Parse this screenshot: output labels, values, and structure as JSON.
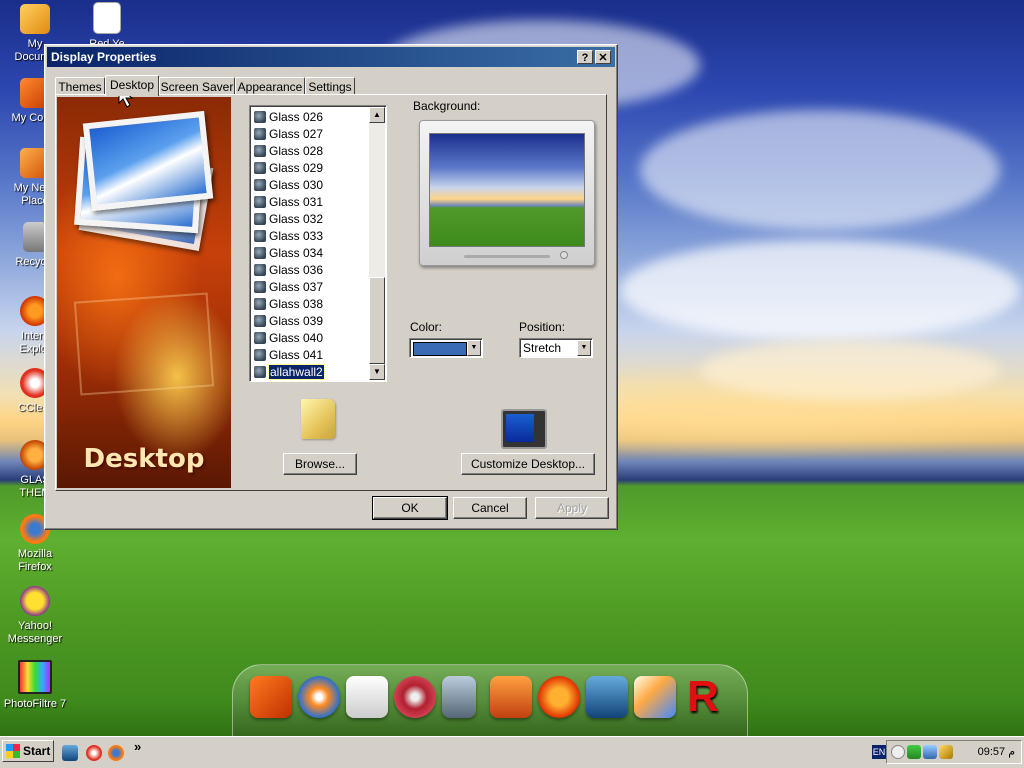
{
  "desktop_icons": [
    {
      "label": "My\nDocume",
      "icon": "my-documents-icon"
    },
    {
      "label": "Red Ye",
      "icon": "document-icon"
    },
    {
      "label": "My Comp",
      "icon": "my-computer-icon"
    },
    {
      "label": "My Netw\nPlace",
      "icon": "network-icon"
    },
    {
      "label": "Recycle",
      "icon": "recycle-bin-icon"
    },
    {
      "label": "Intern\nExplor",
      "icon": "internet-explorer-icon"
    },
    {
      "label": "CClear",
      "icon": "ccleaner-icon"
    },
    {
      "label": "GLAS\nTHEM",
      "icon": "glass-theme-icon"
    },
    {
      "label": "Mozilla Firefox",
      "icon": "firefox-icon"
    },
    {
      "label": "Yahoo!\nMessenger",
      "icon": "yahoo-messenger-icon"
    },
    {
      "label": "PhotoFiltre 7",
      "icon": "photofiltre-icon"
    }
  ],
  "dialog": {
    "title": "Display Properties",
    "help_button": "?",
    "close_button": "✕",
    "tabs": [
      "Themes",
      "Desktop",
      "Screen Saver",
      "Appearance",
      "Settings"
    ],
    "active_tab": "Desktop",
    "promo_label": "Desktop",
    "background_label": "Background:",
    "backgrounds": [
      "Glass 026",
      "Glass 027",
      "Glass 028",
      "Glass 029",
      "Glass 030",
      "Glass 031",
      "Glass 032",
      "Glass 033",
      "Glass 034",
      "Glass 036",
      "Glass 037",
      "Glass 038",
      "Glass 039",
      "Glass 040",
      "Glass 041",
      "allahwall2"
    ],
    "selected_background": "allahwall2",
    "color_label": "Color:",
    "color_value": "#3b6bb5",
    "position_label": "Position:",
    "position_value": "Stretch",
    "browse_button": "Browse...",
    "customize_button": "Customize Desktop...",
    "ok_button": "OK",
    "cancel_button": "Cancel",
    "apply_button": "Apply"
  },
  "dock_icons": [
    "folder-presentation-icon",
    "windows-orb-icon",
    "flash-drive-icon",
    "dvd-icon",
    "recycle-bin-icon",
    "screensaver-icon",
    "internet-explorer-icon",
    "display-icon",
    "paint-icon",
    "r-app-icon"
  ],
  "taskbar": {
    "start_label": "Start",
    "quicklaunch": [
      "show-desktop-icon",
      "browser-icon",
      "firefox-icon"
    ],
    "chevron": "»",
    "language": "EN",
    "clock": "09:57 م"
  }
}
